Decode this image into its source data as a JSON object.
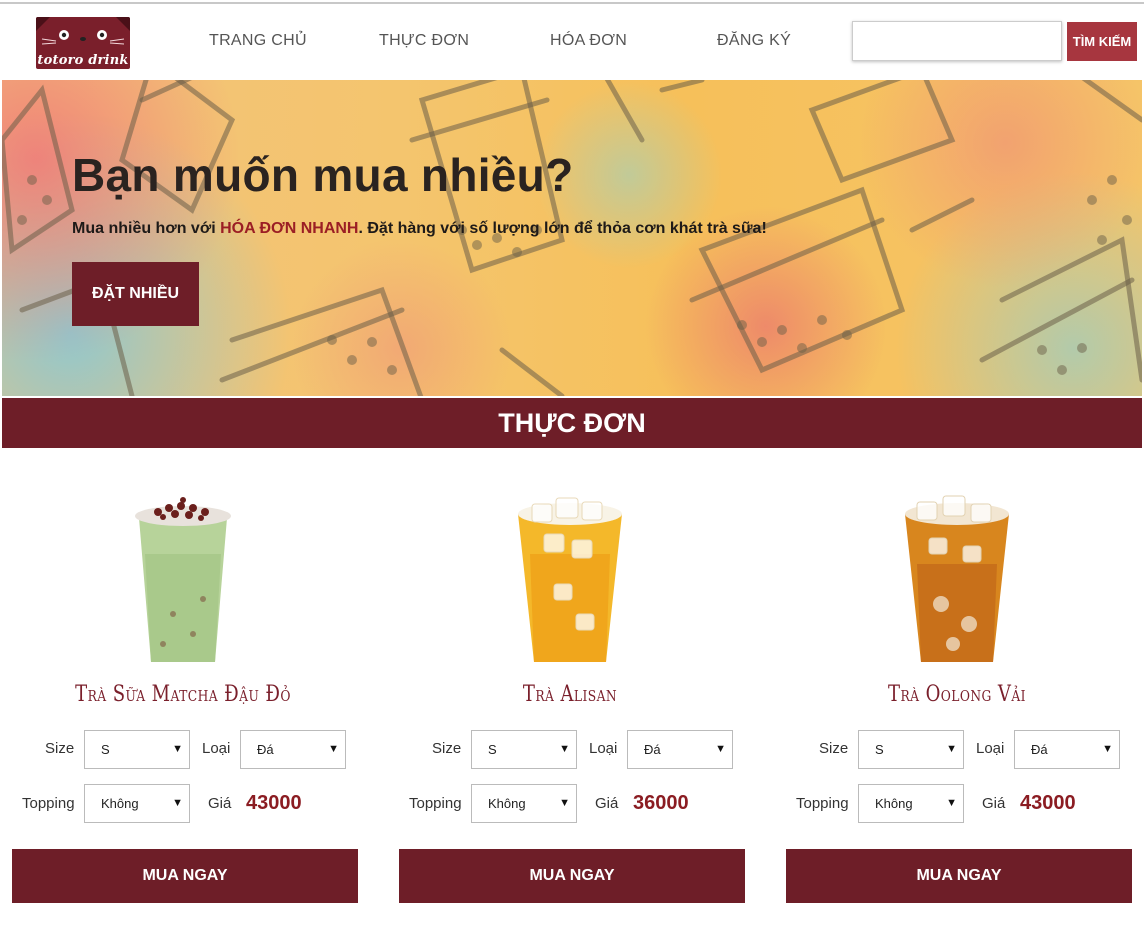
{
  "logo": {
    "text": "totoro drink"
  },
  "nav": [
    "TRANG CHỦ",
    "THỰC ĐƠN",
    "HÓA ĐƠN",
    "ĐĂNG KÝ"
  ],
  "search": {
    "value": "",
    "button_label": "TÌM KIẾM"
  },
  "hero": {
    "title": "Bạn muốn mua nhiều?",
    "text_before": "Mua nhiều hơn với ",
    "text_highlight": "HÓA ĐƠN NHANH",
    "text_after": ". Đặt hàng với số lượng lớn để thỏa cơn khát trà sữa!",
    "button_label": "ĐẶT NHIỀU"
  },
  "menu": {
    "title": "THỰC ĐƠN",
    "labels": {
      "size": "Size",
      "type": "Loại",
      "topping": "Topping",
      "price": "Giá"
    },
    "products": [
      {
        "name": "Trà Sữa Matcha Đậu Đỏ",
        "size": "S",
        "type": "Đá",
        "topping": "Không",
        "price": "43000",
        "buy_label": "MUA NGAY"
      },
      {
        "name": "Trà Alisan",
        "size": "S",
        "type": "Đá",
        "topping": "Không",
        "price": "36000",
        "buy_label": "MUA NGAY"
      },
      {
        "name": "Trà Oolong Vải",
        "size": "S",
        "type": "Đá",
        "topping": "Không",
        "price": "43000",
        "buy_label": "MUA NGAY"
      }
    ]
  },
  "colors": {
    "brand": "#6e1e28",
    "search_button": "#a7363f",
    "price": "#8b1c22",
    "highlight": "#9b1e24"
  }
}
